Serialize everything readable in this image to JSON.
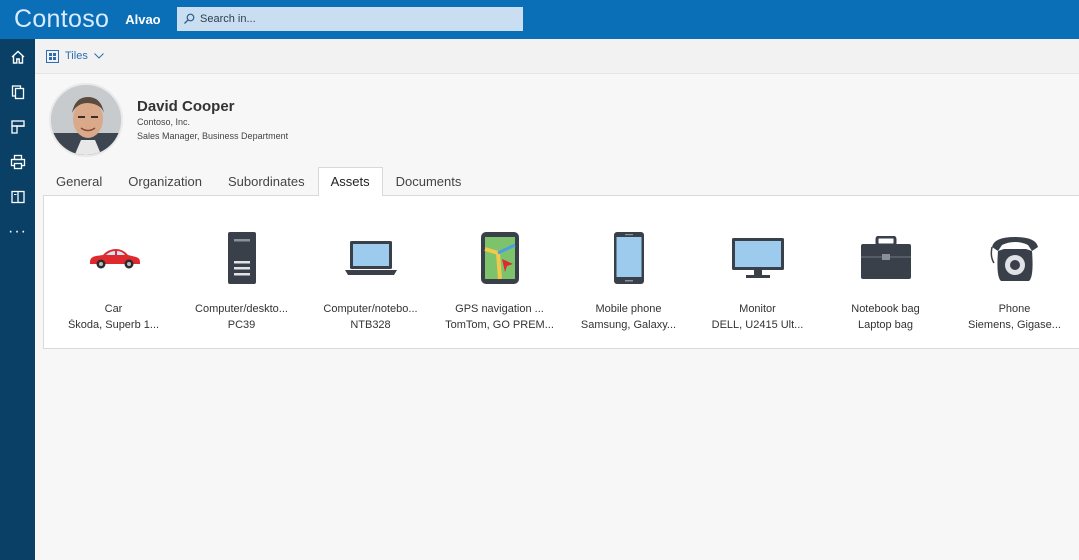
{
  "header": {
    "brand": "Contoso",
    "product": "Alvao",
    "search_placeholder": "Search in..."
  },
  "toolbar": {
    "view_label": "Tiles"
  },
  "profile": {
    "name": "David Cooper",
    "company": "Contoso, Inc.",
    "title": "Sales Manager, Business Department"
  },
  "tabs": [
    {
      "label": "General"
    },
    {
      "label": "Organization"
    },
    {
      "label": "Subordinates"
    },
    {
      "label": "Assets",
      "active": true
    },
    {
      "label": "Documents"
    }
  ],
  "assets": [
    {
      "icon": "car-icon",
      "type": "Car",
      "name": "Škoda, Superb 1..."
    },
    {
      "icon": "desktop-computer-icon",
      "type": "Computer/deskto...",
      "name": "PC39"
    },
    {
      "icon": "laptop-icon",
      "type": "Computer/notebo...",
      "name": "NTB328"
    },
    {
      "icon": "gps-navigation-icon",
      "type": "GPS navigation ...",
      "name": "TomTom, GO PREM..."
    },
    {
      "icon": "mobile-phone-icon",
      "type": "Mobile phone",
      "name": "Samsung, Galaxy..."
    },
    {
      "icon": "monitor-icon",
      "type": "Monitor",
      "name": "DELL, U2415 Ult..."
    },
    {
      "icon": "notebook-bag-icon",
      "type": "Notebook bag",
      "name": "Laptop bag"
    },
    {
      "icon": "phone-icon",
      "type": "Phone",
      "name": "Siemens, Gigase..."
    }
  ],
  "colors": {
    "topbar": "#0b6fb8",
    "leftnav": "#0a3f66",
    "accent": "#2a6fb3"
  }
}
